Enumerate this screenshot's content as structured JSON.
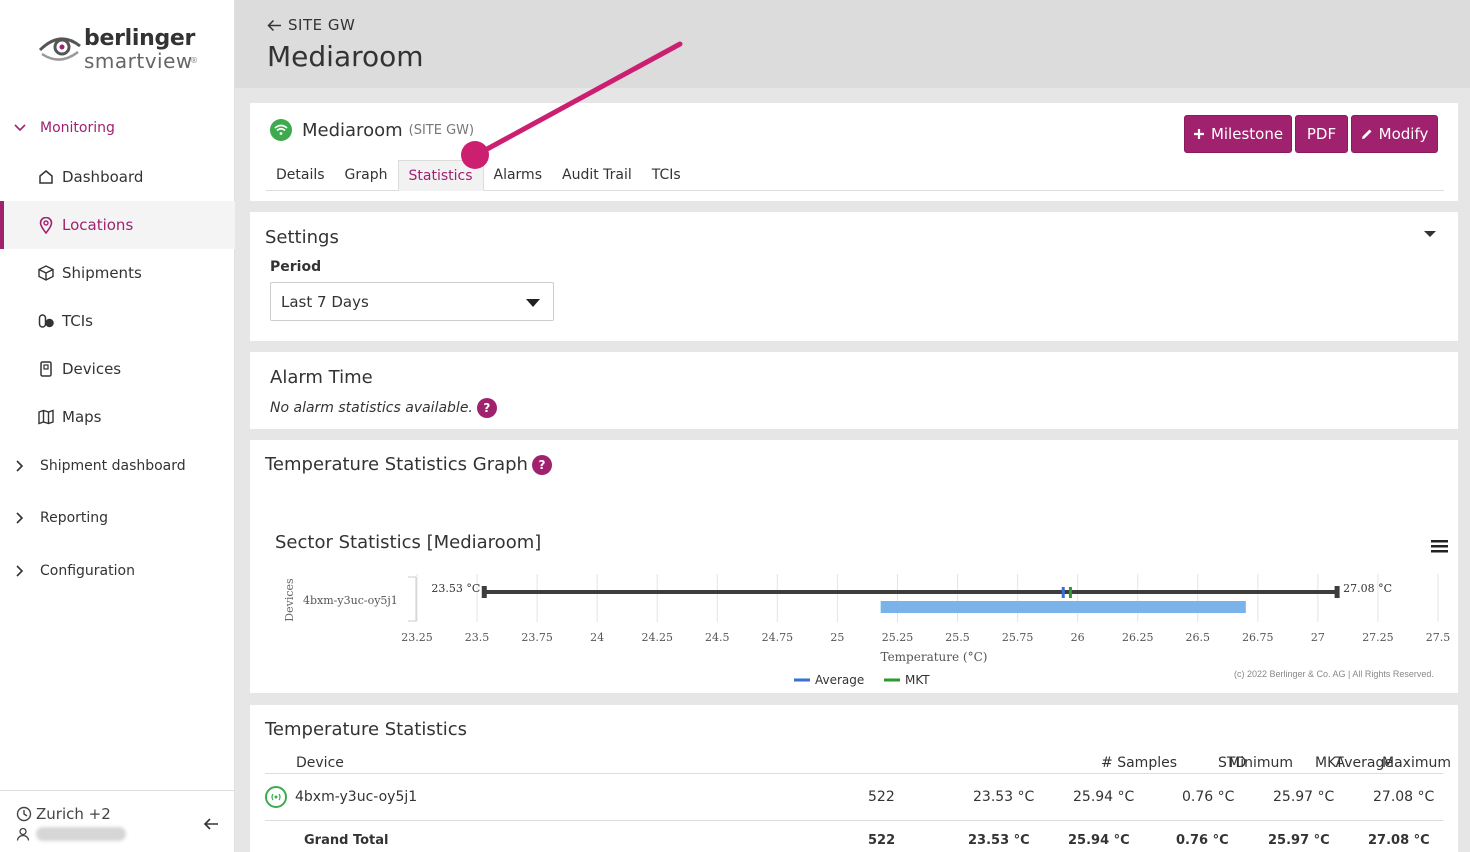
{
  "brand": {
    "line1": "berlinger",
    "line2": "smartview",
    "reg": "®"
  },
  "sidebar": {
    "monitoring": "Monitoring",
    "items": [
      {
        "label": "Dashboard",
        "icon": "home-icon"
      },
      {
        "label": "Locations",
        "icon": "location-pin-icon"
      },
      {
        "label": "Shipments",
        "icon": "box-icon"
      },
      {
        "label": "TCIs",
        "icon": "tci-icon"
      },
      {
        "label": "Devices",
        "icon": "device-icon"
      },
      {
        "label": "Maps",
        "icon": "map-icon"
      }
    ],
    "shipment_dashboard": "Shipment dashboard",
    "reporting": "Reporting",
    "configuration": "Configuration",
    "footer": {
      "location": "Zurich +2"
    }
  },
  "header": {
    "back": "SITE GW",
    "title": "Mediaroom"
  },
  "location_card": {
    "name": "Mediaroom",
    "sub": "(SITE GW)",
    "buttons": {
      "milestone": "Milestone",
      "pdf": "PDF",
      "modify": "Modify"
    },
    "tabs": [
      "Details",
      "Graph",
      "Statistics",
      "Alarms",
      "Audit Trail",
      "TCIs"
    ]
  },
  "settings": {
    "title": "Settings",
    "period_label": "Period",
    "period_value": "Last 7 Days"
  },
  "alarm": {
    "title": "Alarm Time",
    "message": "No alarm statistics available.",
    "help": "?"
  },
  "graph": {
    "title": "Temperature Statistics Graph",
    "help": "?",
    "copyright": "(c) 2022 Berlinger & Co. AG | All Rights Reserved."
  },
  "chart_data": {
    "type": "bar",
    "title": "Sector Statistics [Mediaroom]",
    "xlabel": "Temperature (°C)",
    "ylabel": "Devices",
    "xlim": [
      23.25,
      27.5
    ],
    "xticks": [
      "23.25",
      "23.5",
      "23.75",
      "24",
      "24.25",
      "24.5",
      "24.75",
      "25",
      "25.25",
      "25.5",
      "25.75",
      "26",
      "26.25",
      "26.5",
      "26.75",
      "27",
      "27.25",
      "27.5"
    ],
    "categories": [
      "4bxm-y3uc-oy5j1"
    ],
    "series": [
      {
        "device": "4bxm-y3uc-oy5j1",
        "min": 23.53,
        "max": 27.08,
        "std_low": 25.18,
        "std_high": 26.7,
        "average": 25.94,
        "mkt": 25.97
      }
    ],
    "min_label": "23.53 °C",
    "max_label": "27.08 °C",
    "legend": [
      {
        "name": "Average",
        "color": "#3b6fd6"
      },
      {
        "name": "MKT",
        "color": "#2e9a2e"
      }
    ],
    "legend_position": "bottom",
    "colors": {
      "range": "#3d3d3d",
      "std": "#7ab2ea"
    }
  },
  "stats": {
    "title": "Temperature Statistics",
    "headers": [
      "Device",
      "# Samples",
      "Minimum",
      "Average",
      "STD",
      "MKT",
      "Maximum"
    ],
    "rows": [
      [
        "4bxm-y3uc-oy5j1",
        "522",
        "23.53 °C",
        "25.94 °C",
        "0.76 °C",
        "25.97 °C",
        "27.08 °C"
      ]
    ],
    "total": [
      "Grand Total",
      "522",
      "23.53 °C",
      "25.94 °C",
      "0.76 °C",
      "25.97 °C",
      "27.08 °C"
    ]
  },
  "colors": {
    "accent": "#a0226e",
    "ok": "#3daa4e",
    "annotation": "#cc1f72"
  }
}
